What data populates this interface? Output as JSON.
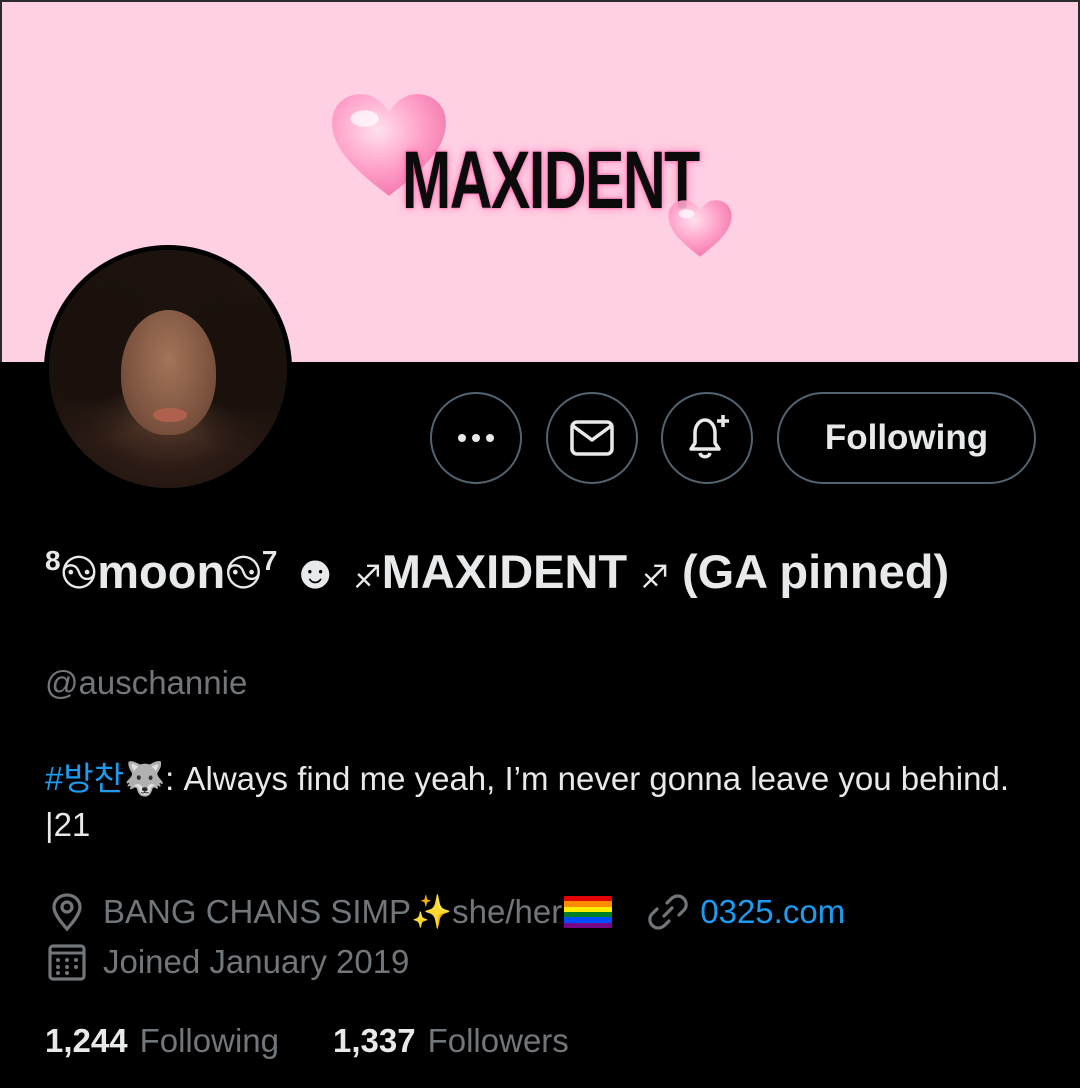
{
  "banner": {
    "logo_text": "MAXIDENT",
    "bg_color": "#ffcfe3"
  },
  "actions": {
    "more_icon": "more-horizontal-icon",
    "message_icon": "envelope-icon",
    "notify_icon": "bell-plus-icon",
    "following_label": "Following"
  },
  "profile": {
    "name_prefix_sup": "8",
    "name_core": "moon",
    "name_suffix_sup": "7",
    "name_tail": "MAXIDENT",
    "name_end": "(GA pinned)",
    "handle": "@auschannie",
    "bio_hashtag": "#방찬",
    "bio_text": ": Always find me yeah, I’m never gonna leave you behind. |21",
    "location": "BANG CHANS SIMP",
    "location_suffix": "she/her",
    "website": "0325.com",
    "joined": "Joined January 2019",
    "following_count": "1,244",
    "following_label": "Following",
    "followers_count": "1,337",
    "followers_label": "Followers"
  },
  "colors": {
    "accent": "#1d9bf0",
    "muted": "#71767b",
    "border": "#536471",
    "text": "#e7e9ea"
  }
}
